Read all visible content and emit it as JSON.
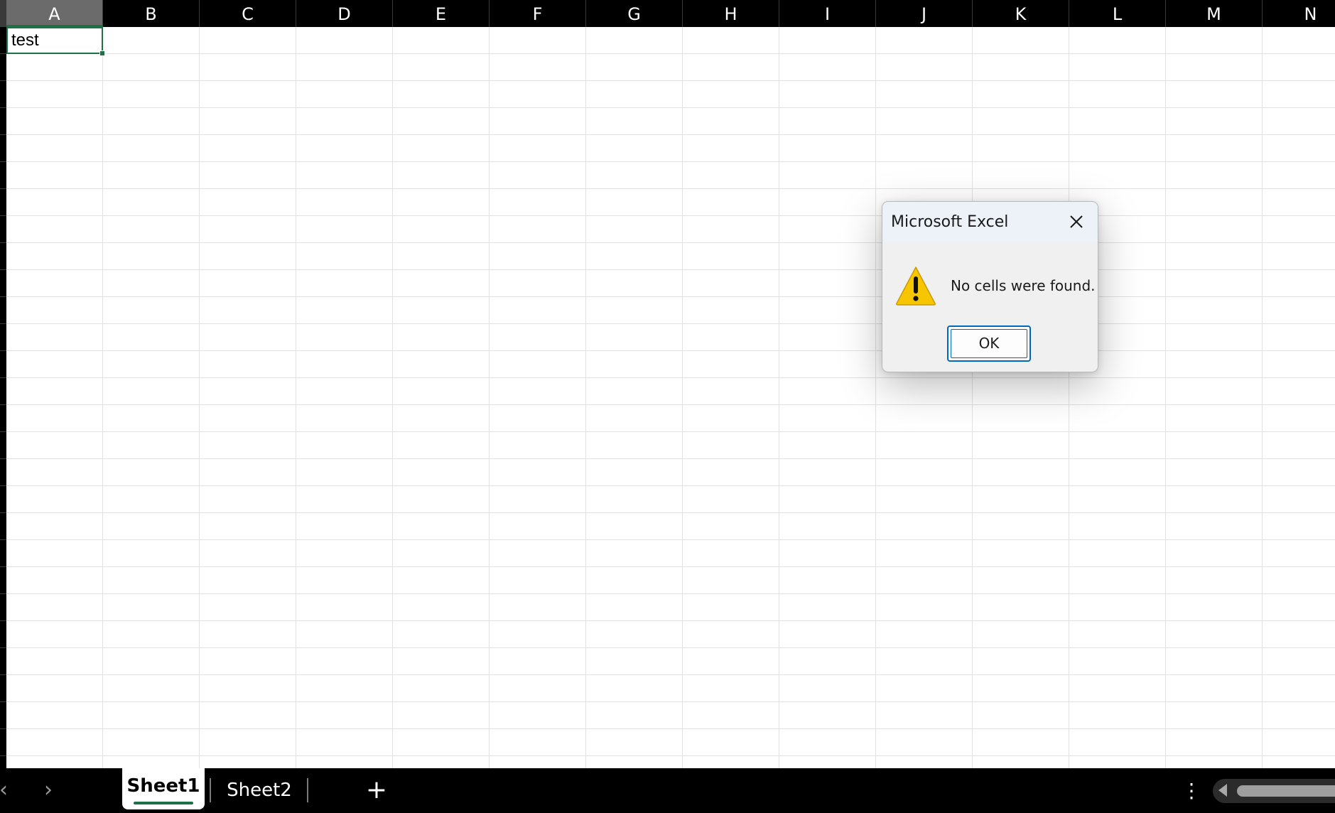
{
  "grid": {
    "columns": [
      "A",
      "B",
      "C",
      "D",
      "E",
      "F",
      "G",
      "H",
      "I",
      "J",
      "K",
      "L",
      "M",
      "N"
    ],
    "selected_column": "A",
    "active_cell": {
      "ref": "A1",
      "value": "test"
    }
  },
  "sheets": {
    "prev_arrow": "‹",
    "next_arrow": "›",
    "tabs": [
      {
        "label": "Sheet1",
        "active": true
      },
      {
        "label": "Sheet2",
        "active": false
      }
    ],
    "add_label": "+",
    "options_label": "⋮"
  },
  "dialog": {
    "title": "Microsoft Excel",
    "message": "No cells were found.",
    "ok_label": "OK",
    "icon": "warning-icon",
    "close_icon": "close-icon"
  },
  "colors": {
    "accent": "#1e7145",
    "dialog_button_border": "#0067c0",
    "warning_yellow": "#f8c600",
    "header_bg": "#000000",
    "gridline": "#e1e1e1"
  }
}
